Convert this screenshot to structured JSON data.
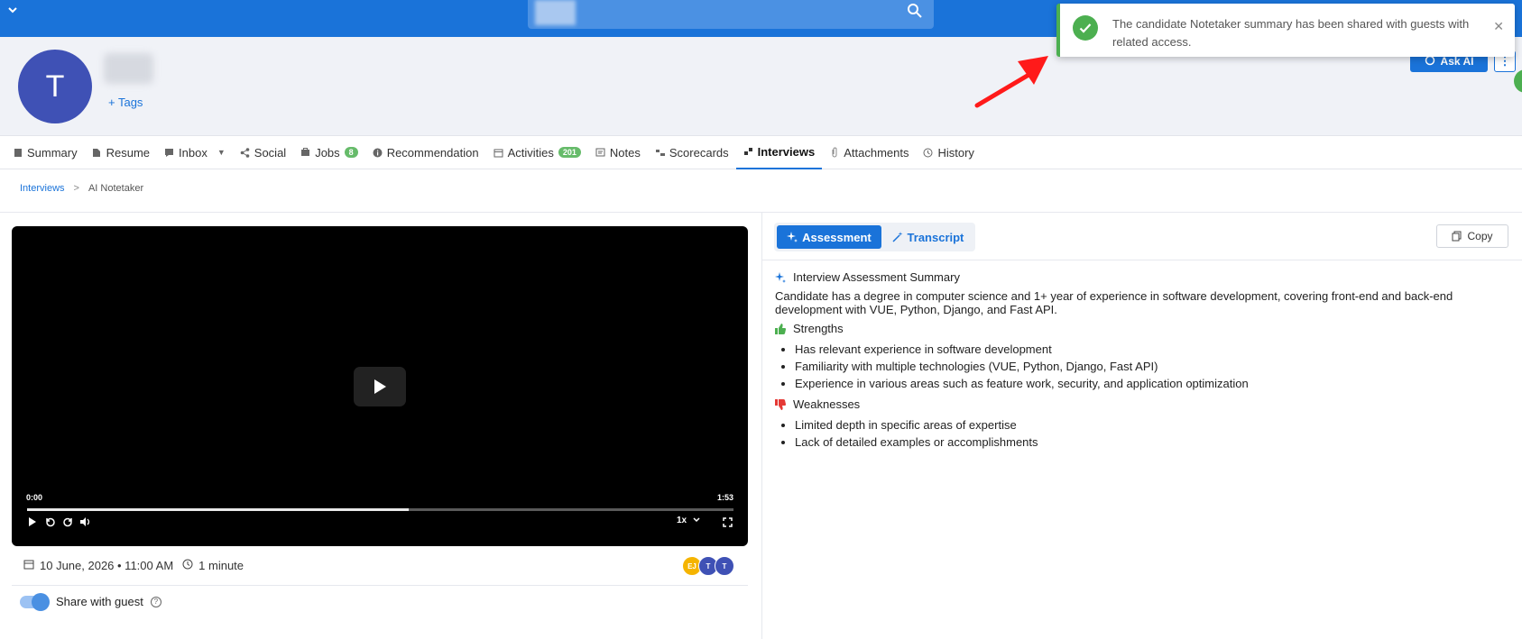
{
  "profile": {
    "avatar_initial": "T",
    "tags_label": "+ Tags",
    "ask_ai_label": "Ask AI"
  },
  "tabs": [
    {
      "label": "Summary",
      "icon": "summary-icon"
    },
    {
      "label": "Resume",
      "icon": "document-icon"
    },
    {
      "label": "Inbox",
      "icon": "chat-icon"
    },
    {
      "label": "Social",
      "icon": "share-icon"
    },
    {
      "label": "Jobs",
      "icon": "briefcase-icon",
      "badge": "8"
    },
    {
      "label": "Recommendation",
      "icon": "info-icon"
    },
    {
      "label": "Activities",
      "icon": "calendar-icon",
      "badge": "201"
    },
    {
      "label": "Notes",
      "icon": "note-icon"
    },
    {
      "label": "Scorecards",
      "icon": "scorecard-icon"
    },
    {
      "label": "Interviews",
      "icon": "interview-icon",
      "active": true
    },
    {
      "label": "Attachments",
      "icon": "paperclip-icon"
    },
    {
      "label": "History",
      "icon": "history-icon"
    }
  ],
  "breadcrumb": {
    "parent": "Interviews",
    "separator": ">",
    "current": "AI Notetaker"
  },
  "video": {
    "time_current": "0:00",
    "time_total": "1:53",
    "progress": 0.54,
    "speed": "1x"
  },
  "meeting": {
    "date": "10 June, 2026 • 11:00 AM",
    "duration": "1 minute",
    "attendees": [
      {
        "initials": "EJ",
        "color": "#f5b400"
      },
      {
        "initials": "T",
        "color": "#3f51b5"
      },
      {
        "initials": "T",
        "color": "#3f51b5"
      }
    ]
  },
  "share": {
    "label": "Share with guest",
    "enabled": true
  },
  "panel": {
    "assessment_label": "Assessment",
    "transcript_label": "Transcript",
    "copy_label": "Copy"
  },
  "summary": {
    "title": "Interview Assessment Summary",
    "text": "Candidate has a degree in computer science and 1+ year of experience in software development, covering front-end and back-end development with VUE, Python, Django, and Fast API.",
    "strengths_title": "Strengths",
    "strengths": [
      "Has relevant experience in software development",
      "Familiarity with multiple technologies (VUE, Python, Django, Fast API)",
      "Experience in various areas such as feature work, security, and application optimization"
    ],
    "weaknesses_title": "Weaknesses",
    "weaknesses": [
      "Limited depth in specific areas of expertise",
      "Lack of detailed examples or accomplishments"
    ]
  },
  "toast": {
    "message": "The candidate Notetaker summary has been shared with guests with related access."
  },
  "colors": {
    "primary": "#1a73d9",
    "success": "#4caf50",
    "danger": "#e53935"
  }
}
